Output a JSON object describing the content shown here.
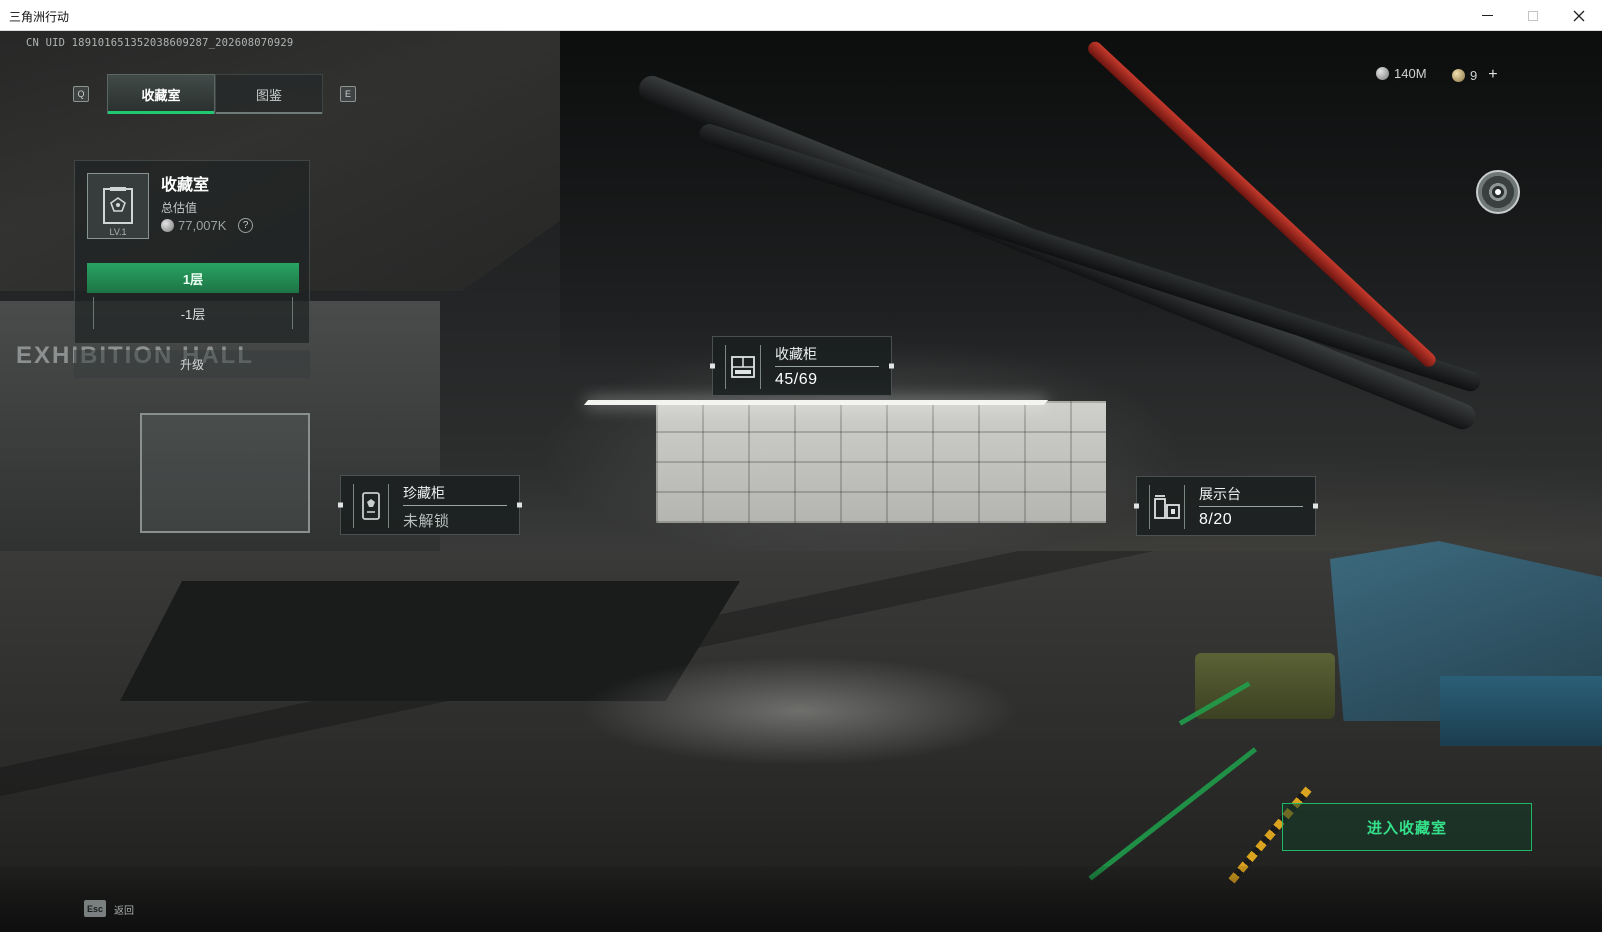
{
  "window": {
    "title": "三角洲行动",
    "minimize_icon": "minimize-icon",
    "maximize_icon": "maximize-icon",
    "close_icon": "close-icon"
  },
  "hud": {
    "uid": "CN UID 189101651352038609287_202608070929",
    "key_prev": "Q",
    "key_next": "E",
    "tabs": [
      {
        "label": "收藏室",
        "active": true
      },
      {
        "label": "图鉴",
        "active": false
      }
    ],
    "resources": {
      "silver": "140M",
      "gold": "9",
      "add_symbol": "+"
    }
  },
  "collection_panel": {
    "title": "收藏室",
    "level": "LV.1",
    "subtitle": "总估值",
    "total_value": "77,007K",
    "help_symbol": "?",
    "floor_current": "1层",
    "floor_other": "-1层",
    "upgrade_label": "升级"
  },
  "scene": {
    "wall_text": "EXHIBITION HALL"
  },
  "markers": {
    "cabinet": {
      "label": "收藏柜",
      "value": "45/69"
    },
    "rare_cabinet": {
      "label": "珍藏柜",
      "value": "未解锁"
    },
    "display_stand": {
      "label": "展示台",
      "value": "8/20"
    }
  },
  "actions": {
    "enter_label": "进入收藏室",
    "esc_key": "Esc",
    "back_label": "返回"
  },
  "colors": {
    "accent_green": "#20c870",
    "enter_text": "#34e08a",
    "panel_bg": "#1e2222"
  }
}
